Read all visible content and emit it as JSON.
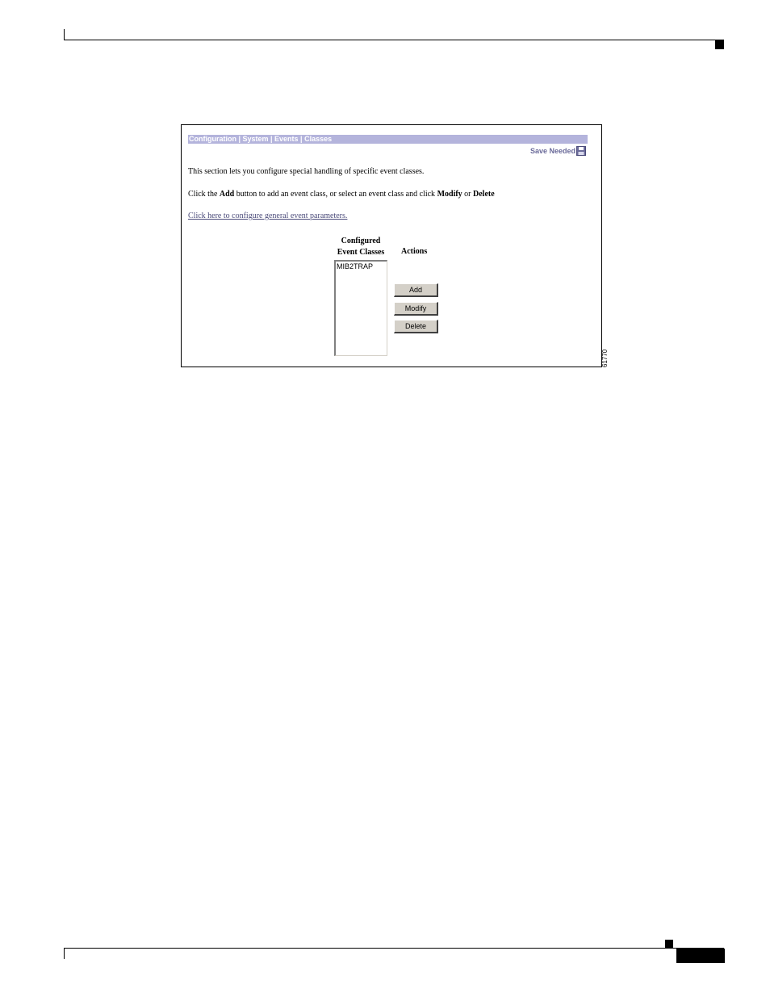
{
  "figure": {
    "breadcrumb": "Configuration | System | Events | Classes",
    "save_needed": "Save Needed",
    "intro_text": "This section lets you configure special handling of specific event classes.",
    "instructions": {
      "part1": "Click the ",
      "add": "Add",
      "part2": " button to add an event class, or select an event class and click ",
      "modify": "Modify",
      "part3": " or ",
      "delete": "Delete"
    },
    "config_link": "Click here to configure general event parameters.",
    "list_heading_line1": "Configured",
    "list_heading_line2": "Event Classes",
    "actions_heading": "Actions",
    "event_classes": [
      "MIB2TRAP"
    ],
    "buttons": {
      "add": "Add",
      "modify": "Modify",
      "delete": "Delete"
    },
    "figure_id": "61770"
  }
}
